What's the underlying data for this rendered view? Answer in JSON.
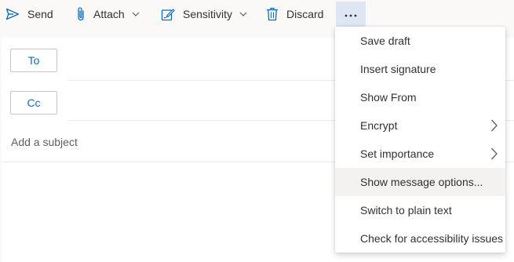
{
  "toolbar": {
    "send_label": "Send",
    "attach_label": "Attach",
    "sensitivity_label": "Sensitivity",
    "discard_label": "Discard",
    "more_icon": "more-horizontal-icon"
  },
  "compose": {
    "to_label": "To",
    "cc_label": "Cc",
    "subject_placeholder": "Add a subject"
  },
  "menu": {
    "items": [
      {
        "label": "Save draft"
      },
      {
        "label": "Insert signature"
      },
      {
        "label": "Show From"
      },
      {
        "label": "Encrypt",
        "has_submenu": true
      },
      {
        "label": "Set importance",
        "has_submenu": true
      },
      {
        "label": "Show message options...",
        "highlighted": true
      },
      {
        "label": "Switch to plain text"
      },
      {
        "label": "Check for accessibility issues"
      }
    ]
  },
  "colors": {
    "accent": "#0f6cbd",
    "more_button_bg": "#dde6f2",
    "menu_hover_bg": "#f3f2f1"
  }
}
